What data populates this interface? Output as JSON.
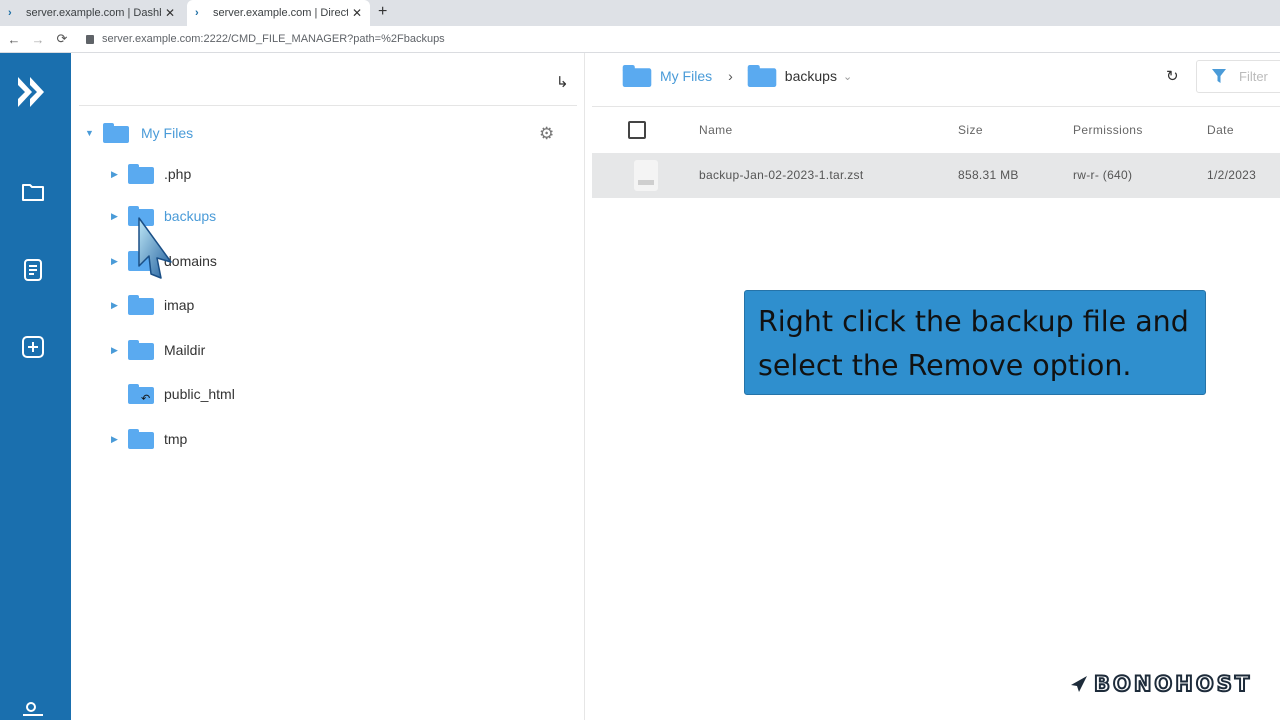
{
  "browser": {
    "tabs": [
      {
        "title": "server.example.com | Dashboard",
        "close": "✕"
      },
      {
        "title": "server.example.com | DirectAdmin",
        "close": "✕"
      }
    ],
    "new_tab": "+",
    "url": "server.example.com:2222/CMD_FILE_MANAGER?path=%2Fbackups"
  },
  "tree": {
    "collapse_icon": "↳",
    "root": {
      "label": "My Files"
    },
    "items": [
      {
        "label": ".php"
      },
      {
        "label": "backups"
      },
      {
        "label": "domains"
      },
      {
        "label": "imap"
      },
      {
        "label": "Maildir"
      },
      {
        "label": "public_html"
      },
      {
        "label": "tmp"
      }
    ]
  },
  "main": {
    "breadcrumb": [
      {
        "label": "My Files"
      },
      {
        "label": "backups"
      }
    ],
    "breadcrumb_sep": "›",
    "dropdown_caret": "⌄",
    "filter_placeholder": "Filter",
    "columns": {
      "name": "Name",
      "size": "Size",
      "permissions": "Permissions",
      "date": "Date"
    },
    "rows": [
      {
        "name": "backup-Jan-02-2023-1.tar.zst",
        "size": "858.31 MB",
        "permissions": "rw-r- (640)",
        "date": "1/2/2023"
      }
    ]
  },
  "annotation": {
    "line1": "Right click the backup file and",
    "line2": "select the Remove option."
  },
  "brand": {
    "name": "BONOHOST"
  },
  "colors": {
    "sidebar": "#1a6fae",
    "folder": "#5aaaf0",
    "link": "#4a9bd8",
    "annotation_bg": "#2f8fce"
  }
}
